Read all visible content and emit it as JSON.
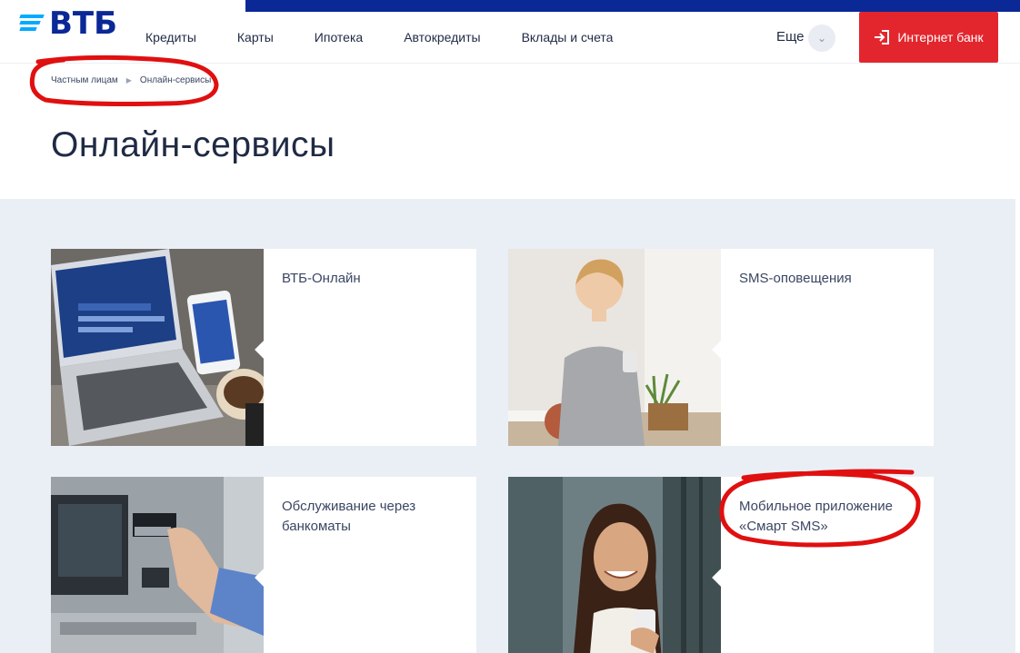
{
  "header": {
    "logo_text": "ВТБ",
    "nav": [
      "Кредиты",
      "Карты",
      "Ипотека",
      "Автокредиты",
      "Вклады и счета"
    ],
    "more_label": "Еще",
    "internet_bank_label": "Интернет банк"
  },
  "breadcrumb": {
    "items": [
      "Частным лицам",
      "Онлайн-сервисы"
    ]
  },
  "page": {
    "title": "Онлайн-сервисы"
  },
  "cards": [
    {
      "label": "ВТБ-Онлайн",
      "photo": "laptop-and-phone-photo"
    },
    {
      "label": "SMS-оповещения",
      "photo": "woman-with-phone-photo"
    },
    {
      "label": "Обслуживание через банкоматы",
      "photo": "atm-photo"
    },
    {
      "label": "Мобильное приложение «Смарт SMS»",
      "photo": "smiling-woman-phone-photo"
    }
  ],
  "colors": {
    "brand_blue": "#0a2896",
    "accent_red": "#e3262e",
    "logo_stripes": "#00aaff",
    "content_bg": "#eaeff6",
    "annotation_red": "#e01010"
  }
}
